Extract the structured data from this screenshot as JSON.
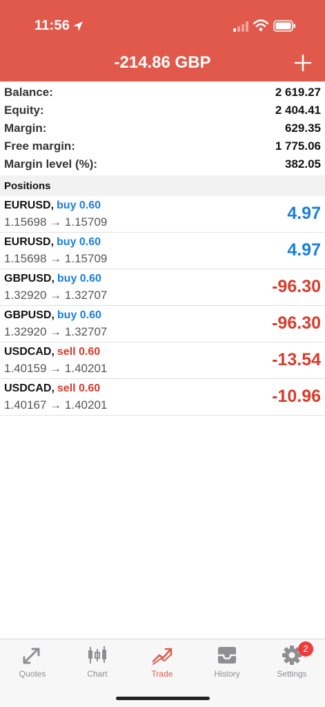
{
  "status": {
    "time": "11:56"
  },
  "header": {
    "title": "-214.86 GBP",
    "add_icon": "plus-icon"
  },
  "summary": [
    {
      "label": "Balance:",
      "value": "2 619.27"
    },
    {
      "label": "Equity:",
      "value": "2 404.41"
    },
    {
      "label": "Margin:",
      "value": "629.35"
    },
    {
      "label": "Free margin:",
      "value": "1 775.06"
    },
    {
      "label": "Margin level (%):",
      "value": "382.05"
    }
  ],
  "positions_header": "Positions",
  "positions": [
    {
      "symbol": "EURUSD,",
      "side": "buy 0.60",
      "prices": "1.15698 → 1.15709",
      "profit": "4.97"
    },
    {
      "symbol": "EURUSD,",
      "side": "buy 0.60",
      "prices": "1.15698 → 1.15709",
      "profit": "4.97"
    },
    {
      "symbol": "GBPUSD,",
      "side": "buy 0.60",
      "prices": "1.32920 → 1.32707",
      "profit": "-96.30"
    },
    {
      "symbol": "GBPUSD,",
      "side": "buy 0.60",
      "prices": "1.32920 → 1.32707",
      "profit": "-96.30"
    },
    {
      "symbol": "USDCAD,",
      "side": "sell 0.60",
      "prices": "1.40159 → 1.40201",
      "profit": "-13.54"
    },
    {
      "symbol": "USDCAD,",
      "side": "sell 0.60",
      "prices": "1.40167 → 1.40201",
      "profit": "-10.96"
    }
  ],
  "tabs": [
    {
      "label": "Quotes",
      "icon": "quotes-arrows-icon"
    },
    {
      "label": "Chart",
      "icon": "candlestick-chart-icon"
    },
    {
      "label": "Trade",
      "icon": "trade-trend-icon",
      "active": true
    },
    {
      "label": "History",
      "icon": "inbox-tray-icon"
    },
    {
      "label": "Settings",
      "icon": "gear-icon"
    }
  ],
  "settings_badge": "2",
  "colors": {
    "header": "#e0594a",
    "buy": "#1a7ee0",
    "sell": "#d93a2a",
    "tab_inactive": "#8e8e93"
  }
}
